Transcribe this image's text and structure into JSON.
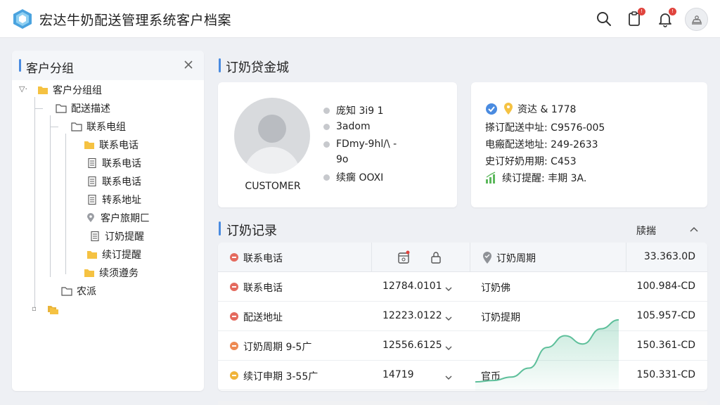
{
  "app": {
    "title": "宏达牛奶配送管理系统客户档案",
    "notification_badge_1": "!",
    "notification_badge_2": "!"
  },
  "left_panel": {
    "title": "客户分组",
    "tree": [
      {
        "label": "客户分组组",
        "icon": "folder-yellow-icon"
      },
      {
        "label": "配送描述",
        "icon": "folder-outline-icon"
      },
      {
        "label": "联系电组",
        "icon": "folder-outline-icon"
      },
      {
        "label": "联系电话",
        "icon": "folder-yellow-icon"
      },
      {
        "label": "联系电话",
        "icon": "document-icon"
      },
      {
        "label": "联系电话",
        "icon": "document-icon"
      },
      {
        "label": "转系地址",
        "icon": "document-icon"
      },
      {
        "label": "客户旅期匚",
        "icon": "location-pin-icon"
      },
      {
        "label": "订奶提醒",
        "icon": "document-icon"
      },
      {
        "label": "续订提醒",
        "icon": "folder-yellow-icon"
      },
      {
        "label": "续须遵务",
        "icon": "folder-yellow-icon"
      },
      {
        "label": "农派",
        "icon": "folder-outline-icon"
      },
      {
        "label": "",
        "icon": "folder-stack-icon"
      }
    ]
  },
  "order_info": {
    "section_title": "订奶贷金城",
    "photo_label": "CUSTOMER",
    "rows": [
      "庞知  3i9 1",
      "3adom",
      "FDmy-9hl/\\ -",
      "9o",
      "续瘸  OOXI"
    ]
  },
  "detail_card": {
    "rows": [
      {
        "icon": "verified-check-icon",
        "label": "资达 & 1778"
      },
      {
        "icon": "",
        "label": "搽订配送中址: C9576-005"
      },
      {
        "icon": "",
        "label": "电瘢配送地址: 249-2633"
      },
      {
        "icon": "",
        "label": "史订好奶用期: C453"
      },
      {
        "icon": "growth-bars-icon",
        "label": "续订提醒: 丰期 3A."
      }
    ]
  },
  "records": {
    "section_title": "订奶记录",
    "sort_label": "牍揣",
    "header": {
      "col1": "联系电话",
      "col3": "订奶周期",
      "col4": "33.363.0D"
    },
    "rows": [
      {
        "name": "联系电话",
        "amount": "12784.0101",
        "type": "订奶佛",
        "total": "100.984-CD",
        "dot": "#e46a5e"
      },
      {
        "name": "配送地址",
        "amount": "12223.0122",
        "type": "订奶提期",
        "total": "105.957-CD",
        "dot": "#e46a5e"
      },
      {
        "name": "订奶周期  9-5广",
        "amount": "12556.6125",
        "type": "",
        "total": "150.361-CD",
        "dot": "#ee8a52"
      },
      {
        "name": "续订申期  3-55广",
        "amount": "14719",
        "type": "官币",
        "total": "150.331-CD",
        "dot": "#f0b43a"
      }
    ],
    "trend_data": [
      0.05,
      0.07,
      0.12,
      0.25,
      0.55,
      0.72,
      0.6,
      0.82,
      0.95
    ]
  },
  "colors": {
    "accent": "#4a8be0",
    "folder": "#f5c242",
    "trend": "#5dbf9a"
  }
}
